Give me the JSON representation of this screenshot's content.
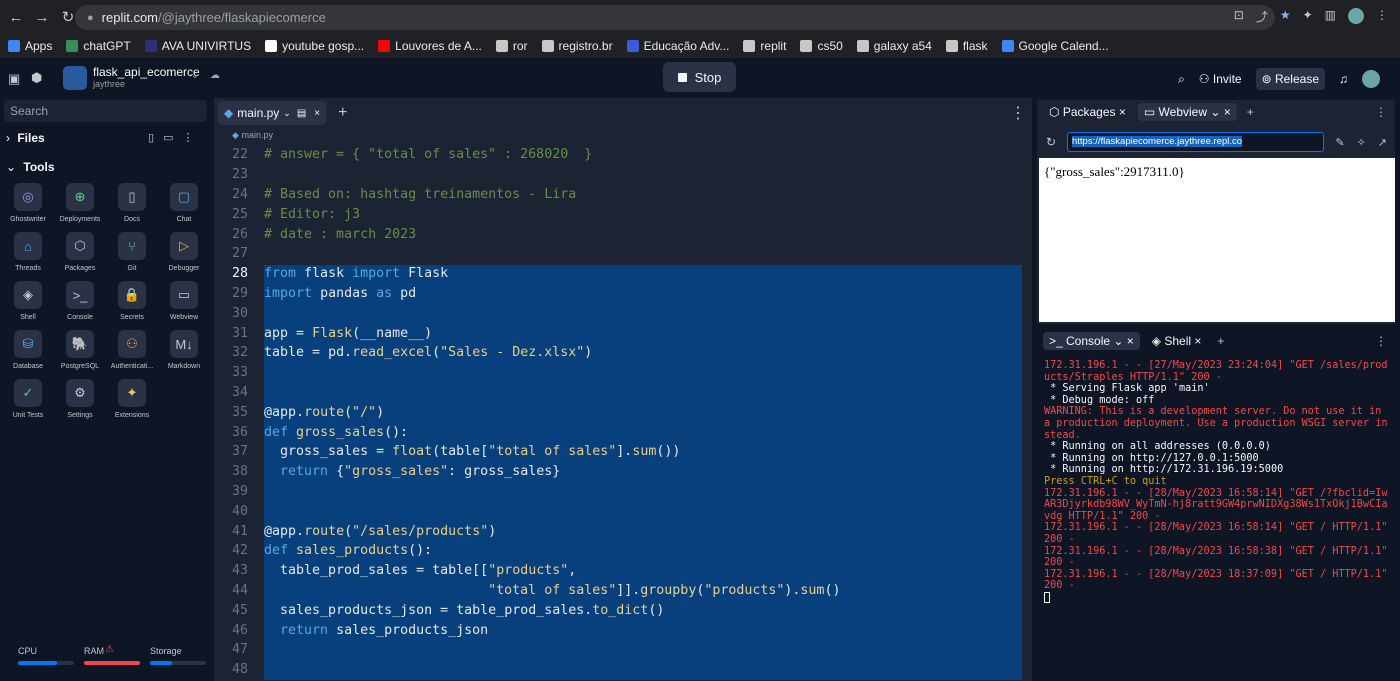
{
  "browser": {
    "url_host": "replit.com",
    "url_path": "/@jaythree/flaskapiecomerce",
    "bookmarks": [
      "Apps",
      "chatGPT",
      "AVA UNIVIRTUS",
      "youtube gosp...",
      "Louvores de A...",
      "ror",
      "registro.br",
      "Educação Adv...",
      "replit",
      "cs50",
      "galaxy a54",
      "flask",
      "Google Calend..."
    ]
  },
  "topbar": {
    "repo_name": "flask_api_ecomerce",
    "owner": "jaythree",
    "stop_label": "Stop",
    "invite_label": "Invite",
    "release_label": "Release"
  },
  "sidebar": {
    "search_placeholder": "Search",
    "files_label": "Files",
    "tools_label": "Tools",
    "tools": [
      "Ghostwriter",
      "Deployments",
      "Docs",
      "Chat",
      "Threads",
      "Packages",
      "Git",
      "Debugger",
      "Shell",
      "Console",
      "Secrets",
      "Webview",
      "Database",
      "PostgreSQL",
      "Authenticati...",
      "Markdown",
      "Unit Tests",
      "Settings",
      "Extensions"
    ],
    "resources": {
      "cpu_label": "CPU",
      "ram_label": "RAM",
      "storage_label": "Storage",
      "cpu_level": 0.7,
      "ram_level": 1.0,
      "storage_level": 0.4
    }
  },
  "editor": {
    "tab_label": "main.py",
    "breadcrumb": "main.py",
    "line_numbers": [
      "22",
      "23",
      "24",
      "25",
      "26",
      "27",
      "28",
      "29",
      "30",
      "31",
      "32",
      "33",
      "34",
      "35",
      "36",
      "37",
      "38",
      "39",
      "40",
      "41",
      "42",
      "43",
      "44",
      "45",
      "46",
      "47",
      "48"
    ],
    "code_lines": [
      "# answer = { \"total of sales\" : 268020  }",
      "",
      "# Based on: hashtag treinamentos - Lira",
      "# Editor: j3",
      "# date : march 2023",
      "",
      "from flask import Flask",
      "import pandas as pd",
      "",
      "app = Flask(__name__)",
      "table = pd.read_excel(\"Sales - Dez.xlsx\")",
      "",
      "",
      "@app.route(\"/\")",
      "def gross_sales():",
      "  gross_sales = float(table[\"total of sales\"].sum())",
      "  return {\"gross_sales\": gross_sales}",
      "",
      "",
      "@app.route(\"/sales/products\")",
      "def sales_products():",
      "  table_prod_sales = table[[\"products\",",
      "                            \"total of sales\"]].groupby(\"products\").sum()",
      "  sales_products_json = table_prod_sales.to_dict()",
      "  return sales_products_json",
      "",
      ""
    ]
  },
  "webview_pane": {
    "tabs": [
      "Packages",
      "Webview"
    ],
    "url": "https://flaskapiecomerce.jaythree.repl.co",
    "body": "{\"gross_sales\":2917311.0}"
  },
  "console_pane": {
    "tabs": [
      "Console",
      "Shell"
    ],
    "lines": [
      {
        "c": "r",
        "t": "172.31.196.1 - - [27/May/2023 23:24:04] \"GET /sales/products/Straples HTTP/1.1\" 200 -"
      },
      {
        "c": "w",
        "t": " * Serving Flask app 'main'"
      },
      {
        "c": "w",
        "t": " * Debug mode: off"
      },
      {
        "c": "r",
        "t": "WARNING: This is a development server. Do not use it in a production deployment. Use a production WSGI server instead."
      },
      {
        "c": "w",
        "t": " * Running on all addresses (0.0.0.0)"
      },
      {
        "c": "w",
        "t": " * Running on http://127.0.0.1:5000"
      },
      {
        "c": "w",
        "t": " * Running on http://172.31.196.19:5000"
      },
      {
        "c": "y",
        "t": "Press CTRL+C to quit"
      },
      {
        "c": "r",
        "t": "172.31.196.1 - - [28/May/2023 16:58:14] \"GET /?fbclid=IwAR3Djyrkdb98WV_WyTmN-hj8ratt9GW4prwNIDXg38Ws1TxOkj1BwCIavdg HTTP/1.1\" 200 -"
      },
      {
        "c": "r",
        "t": "172.31.196.1 - - [28/May/2023 16:58:14] \"GET / HTTP/1.1\" 200 -"
      },
      {
        "c": "r",
        "t": "172.31.196.1 - - [28/May/2023 16:58:38] \"GET / HTTP/1.1\" 200 -"
      },
      {
        "c": "r",
        "t": "172.31.196.1 - - [28/May/2023 18:37:09] \"GET / HTTP/1.1\" 200 -"
      }
    ]
  }
}
